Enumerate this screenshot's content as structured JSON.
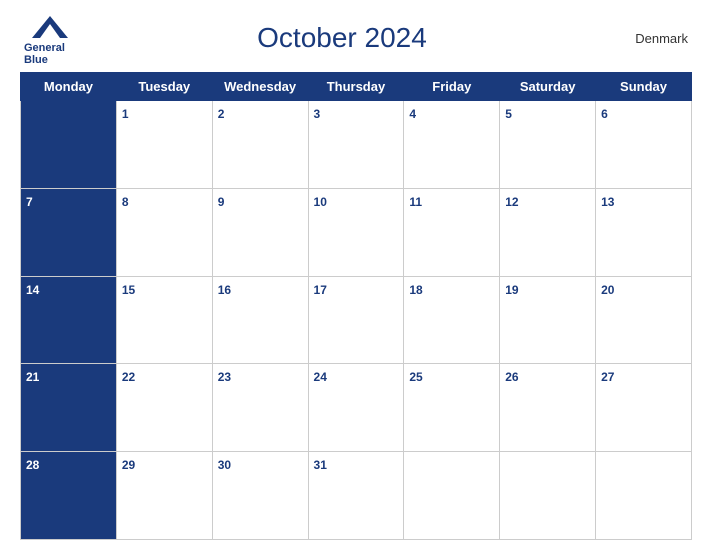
{
  "header": {
    "logo_line1": "General",
    "logo_line2": "Blue",
    "title": "October 2024",
    "country": "Denmark"
  },
  "weekdays": [
    "Monday",
    "Tuesday",
    "Wednesday",
    "Thursday",
    "Friday",
    "Saturday",
    "Sunday"
  ],
  "weeks": [
    {
      "days": [
        {
          "num": "",
          "isStart": true
        },
        {
          "num": "1"
        },
        {
          "num": "2"
        },
        {
          "num": "3"
        },
        {
          "num": "4"
        },
        {
          "num": "5"
        },
        {
          "num": "6"
        }
      ]
    },
    {
      "days": [
        {
          "num": "7",
          "isStart": true
        },
        {
          "num": "8"
        },
        {
          "num": "9"
        },
        {
          "num": "10"
        },
        {
          "num": "11"
        },
        {
          "num": "12"
        },
        {
          "num": "13"
        }
      ]
    },
    {
      "days": [
        {
          "num": "14",
          "isStart": true
        },
        {
          "num": "15"
        },
        {
          "num": "16"
        },
        {
          "num": "17"
        },
        {
          "num": "18"
        },
        {
          "num": "19"
        },
        {
          "num": "20"
        }
      ]
    },
    {
      "days": [
        {
          "num": "21",
          "isStart": true
        },
        {
          "num": "22"
        },
        {
          "num": "23"
        },
        {
          "num": "24"
        },
        {
          "num": "25"
        },
        {
          "num": "26"
        },
        {
          "num": "27"
        }
      ]
    },
    {
      "days": [
        {
          "num": "28",
          "isStart": true
        },
        {
          "num": "29"
        },
        {
          "num": "30"
        },
        {
          "num": "31"
        },
        {
          "num": ""
        },
        {
          "num": ""
        },
        {
          "num": ""
        }
      ]
    }
  ]
}
